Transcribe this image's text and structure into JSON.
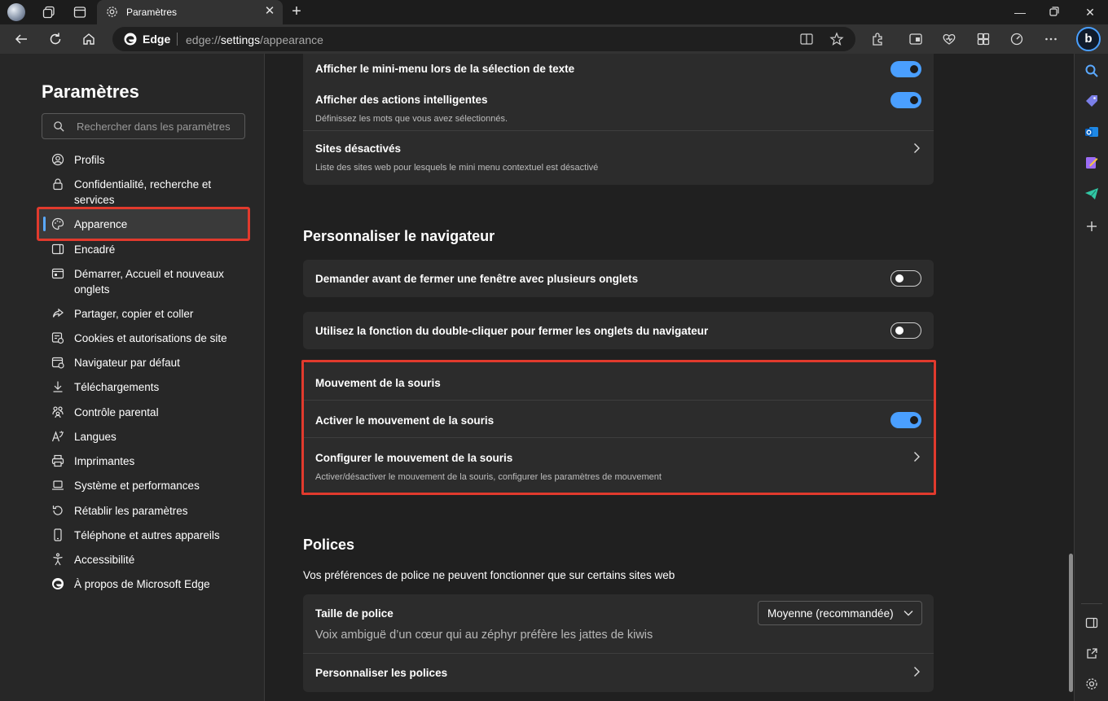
{
  "tab": {
    "title": "Paramètres"
  },
  "address": {
    "brand": "Edge",
    "url_prefix": "edge://",
    "url_host": "settings",
    "url_path": "/appearance"
  },
  "nav": {
    "title": "Paramètres",
    "search_placeholder": "Rechercher dans les paramètres",
    "items": [
      {
        "label": "Profils",
        "icon": "profile-icon"
      },
      {
        "label": "Confidentialité, recherche et services",
        "icon": "lock-icon"
      },
      {
        "label": "Apparence",
        "icon": "palette-icon",
        "active": true
      },
      {
        "label": "Encadré",
        "icon": "sidebar-icon"
      },
      {
        "label": "Démarrer, Accueil et nouveaux onglets",
        "icon": "home-tabs-icon"
      },
      {
        "label": "Partager, copier et coller",
        "icon": "share-icon"
      },
      {
        "label": "Cookies et autorisations de site",
        "icon": "cookies-icon"
      },
      {
        "label": "Navigateur par défaut",
        "icon": "default-browser-icon"
      },
      {
        "label": "Téléchargements",
        "icon": "download-icon"
      },
      {
        "label": "Contrôle parental",
        "icon": "family-icon"
      },
      {
        "label": "Langues",
        "icon": "language-icon"
      },
      {
        "label": "Imprimantes",
        "icon": "printer-icon"
      },
      {
        "label": "Système et performances",
        "icon": "laptop-icon"
      },
      {
        "label": "Rétablir les paramètres",
        "icon": "reset-icon"
      },
      {
        "label": "Téléphone et autres appareils",
        "icon": "phone-icon"
      },
      {
        "label": "Accessibilité",
        "icon": "accessibility-icon"
      },
      {
        "label": "À propos de Microsoft Edge",
        "icon": "edge-icon"
      }
    ]
  },
  "minimenu": {
    "show_label": "Afficher le mini-menu lors de la sélection de texte",
    "show_on": true,
    "smart_label": "Afficher des actions intelligentes",
    "smart_sub": "Définissez les mots que vous avez sélectionnés.",
    "smart_on": true,
    "disabled_sites_label": "Sites désactivés",
    "disabled_sites_sub": "Liste des sites web pour lesquels le mini menu contextuel est désactivé"
  },
  "customize": {
    "heading": "Personnaliser le navigateur",
    "ask_close_label": "Demander avant de fermer une fenêtre avec plusieurs onglets",
    "ask_close_on": false,
    "double_click_label": "Utilisez la fonction du double-cliquer pour fermer les onglets du navigateur",
    "double_click_on": false
  },
  "mouse": {
    "title": "Mouvement de la souris",
    "enable_label": "Activer le mouvement de la souris",
    "enable_on": true,
    "configure_label": "Configurer le mouvement de la souris",
    "configure_sub": "Activer/désactiver le mouvement de la souris, configurer les paramètres de mouvement"
  },
  "fonts": {
    "heading": "Polices",
    "note": "Vos préférences de police ne peuvent fonctionner que sur certains sites web",
    "size_label": "Taille de police",
    "size_value": "Moyenne (recommandée)",
    "preview": "Voix ambiguë d’un cœur qui au zéphyr préfère les jattes de kiwis",
    "customize_label": "Personnaliser les polices"
  },
  "colors": {
    "accent": "#4a9fff",
    "highlight": "#e13a2d"
  }
}
